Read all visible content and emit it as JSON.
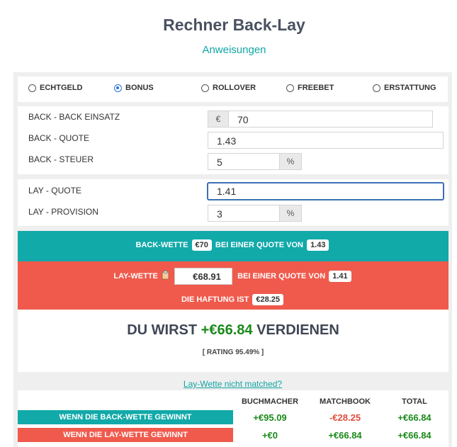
{
  "header": {
    "title": "Rechner Back-Lay",
    "subtitle": "Anweisungen"
  },
  "modes": [
    {
      "label": "ECHTGELD",
      "selected": false
    },
    {
      "label": "BONUS",
      "selected": true
    },
    {
      "label": "ROLLOVER",
      "selected": false
    },
    {
      "label": "FREEBET",
      "selected": false
    },
    {
      "label": "ERSTATTUNG",
      "selected": false
    }
  ],
  "back": {
    "stake_label": "BACK - BACK EINSATZ",
    "currency_symbol": "€",
    "stake_value": "70",
    "odds_label": "BACK - QUOTE",
    "odds_value": "1.43",
    "tax_label": "BACK - STEUER",
    "tax_value": "5",
    "percent_symbol": "%"
  },
  "lay": {
    "odds_label": "LAY - QUOTE",
    "odds_value": "1.41",
    "commission_label": "LAY - PROVISION",
    "commission_value": "3",
    "percent_symbol": "%"
  },
  "summary": {
    "back_bet_label": "BACK-WETTE",
    "back_bet_amount": "€70",
    "at_odds_label": "BEI EINER QUOTE VON",
    "back_odds": "1.43",
    "lay_bet_label": "LAY-WETTE",
    "lay_bet_amount": "€68.91",
    "lay_odds": "1.41",
    "liability_label": "DIE HAFTUNG IST",
    "liability_amount": "€28.25"
  },
  "result": {
    "prefix": "DU WIRST",
    "profit": "+€66.84",
    "suffix": "VERDIENEN",
    "rating": "[ RATING 95.49% ]"
  },
  "link_text": "Lay-Wette nicht matched?",
  "table": {
    "columns": [
      "BUCHMACHER",
      "MATCHBOOK",
      "TOTAL"
    ],
    "rows": [
      {
        "label": "WENN DIE BACK-WETTE GEWINNT",
        "values": [
          "+€95.09",
          "-€28.25",
          "+€66.84"
        ]
      },
      {
        "label": "WENN DIE LAY-WETTE GEWINNT",
        "values": [
          "+€0",
          "+€66.84",
          "+€66.84"
        ]
      }
    ]
  },
  "colors": {
    "teal": "#12a9a9",
    "red": "#ef5a4c",
    "positive": "#1a8a1a",
    "negative": "#e04c3c"
  }
}
